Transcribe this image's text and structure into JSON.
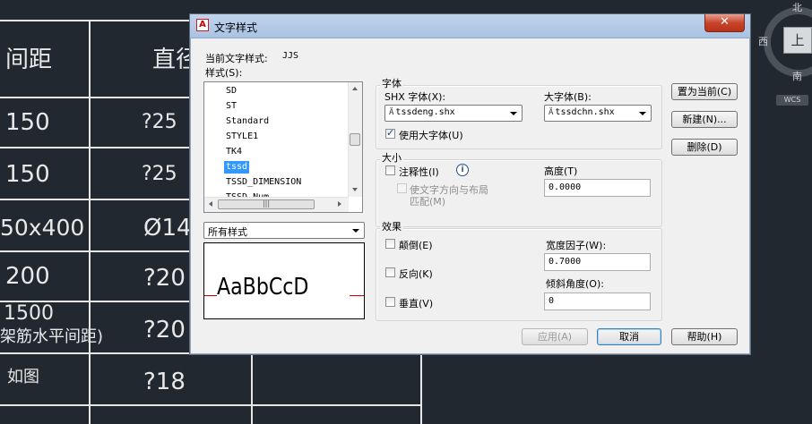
{
  "cad": {
    "col1": [
      "间距",
      "150",
      "150",
      "50x400",
      "200",
      "1500",
      "架筋水平间距)",
      "如图"
    ],
    "col2": [
      "直径",
      "?25",
      "?25",
      "Ø14",
      "?20",
      "?20",
      "?18"
    ]
  },
  "viewcube": {
    "north": "北",
    "south": "南",
    "west": "西",
    "face": "上",
    "wcs": "WCS"
  },
  "dialog": {
    "title": "文字样式",
    "close": "✕",
    "current_style_label": "当前文字样式:",
    "current_style_value": "JJS",
    "styles_label": "样式(S):",
    "styles": [
      "SD",
      "ST",
      "Standard",
      "STYLE1",
      "TK4",
      "tssd",
      "TSSD_DIMENSION",
      "TSSD_Num"
    ],
    "selected_style": "tssd",
    "filter_value": "所有样式",
    "preview_text": "AaBbCcD",
    "font_group": {
      "title": "字体",
      "shx_label": "SHX 字体(X):",
      "shx_value": "tssdeng.shx",
      "big_font_label": "大字体(B):",
      "big_font_value": "tssdchn.shx",
      "use_big_font_label": "使用大字体(U)",
      "use_big_font_checked": true
    },
    "size_group": {
      "title": "大小",
      "annotative_label": "注释性(I)",
      "match_orientation_line1": "使文字方向与布局",
      "match_orientation_line2": "匹配(M)",
      "height_label": "高度(T)",
      "height_value": "0.0000"
    },
    "effects_group": {
      "title": "效果",
      "upside_down_label": "颠倒(E)",
      "backwards_label": "反向(K)",
      "vertical_label": "垂直(V)",
      "width_factor_label": "宽度因子(W):",
      "width_factor_value": "0.7000",
      "oblique_label": "倾斜角度(O):",
      "oblique_value": "0"
    },
    "buttons": {
      "set_current": "置为当前(C)",
      "new": "新建(N)...",
      "delete": "删除(D)",
      "apply": "应用(A)",
      "cancel": "取消",
      "help": "帮助(H)"
    }
  }
}
